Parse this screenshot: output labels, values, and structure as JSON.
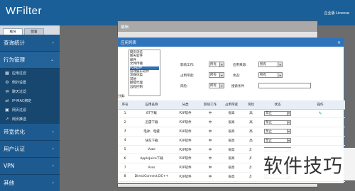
{
  "header": {
    "title": "WFilter",
    "license": "企业版 License"
  },
  "sidebar": {
    "tabs": [
      {
        "label": "概况"
      },
      {
        "label": "配置"
      }
    ],
    "sections": [
      {
        "label": "查询统计",
        "chevron": "›"
      },
      {
        "label": "行为管理",
        "chevron": "⌄"
      },
      {
        "label": "带宽优化",
        "chevron": "›"
      },
      {
        "label": "用户认证",
        "chevron": "›"
      },
      {
        "label": "VPN",
        "chevron": "›"
      },
      {
        "label": "其他",
        "chevron": "›"
      }
    ],
    "sub_items": [
      {
        "label": "应用过滤",
        "icon": "grid-icon",
        "glyph": "▦"
      },
      {
        "label": "例外设置",
        "icon": "gear-icon",
        "glyph": "⚙"
      },
      {
        "label": "聊天过滤",
        "icon": "chat-icon",
        "glyph": "✉"
      },
      {
        "label": "IP-MAC绑定",
        "icon": "link-icon",
        "glyph": "⇄"
      },
      {
        "label": "网页过滤",
        "icon": "web-icon",
        "glyph": "▣"
      },
      {
        "label": "网页推送",
        "icon": "push-icon",
        "glyph": "↗"
      }
    ]
  },
  "outer_modal": {
    "title": "编辑"
  },
  "modal": {
    "title": "应用列表",
    "close": "×",
    "categories": [
      "网页浏览",
      "聊天软件",
      "邮件",
      "文件传输",
      "P2P软件",
      "游戏娱乐软件",
      "流媒体类",
      "其他",
      "翻墙代理",
      "远程控制"
    ],
    "selected_category": "P2P软件",
    "category_label": "分类:",
    "filters": {
      "impact_label": "影响工作:",
      "impact_value": "所有",
      "source_label": "应用来源:",
      "source_value": "所有",
      "bandwidth_label": "占用带宽:",
      "bandwidth_value": "所有",
      "status_label": "状态:",
      "status_value": "所有",
      "risk_label": "风险:",
      "risk_value": "所有",
      "search_label": "搜索条件",
      "search_value": ""
    },
    "table": {
      "headers": [
        "序号",
        "应用名称",
        "分类",
        "影响工作",
        "占用带宽",
        "风险",
        "状态",
        "操作"
      ],
      "rows": [
        {
          "no": "1",
          "name": "BT下载",
          "category": "P2P软件",
          "impact": "中",
          "bandwidth": "很高",
          "risk": "高",
          "status": "禁止"
        },
        {
          "no": "2",
          "name": "迅雷下载",
          "category": "P2P软件",
          "impact": "中",
          "bandwidth": "很高",
          "risk": "高",
          "status": "禁止"
        },
        {
          "no": "3",
          "name": "电驴、电骡",
          "category": "P2P软件",
          "impact": "中",
          "bandwidth": "很高",
          "risk": "高",
          "status": "禁止"
        },
        {
          "no": "4",
          "name": "快车下载",
          "category": "P2P软件",
          "impact": "中",
          "bandwidth": "很高",
          "risk": "高",
          "status": "禁止"
        },
        {
          "no": "5",
          "name": "Vuze",
          "category": "P2P软件",
          "impact": "中",
          "bandwidth": "很高",
          "risk": "高",
          "status": "禁止"
        },
        {
          "no": "6",
          "name": "AppleJuice下载",
          "category": "P2P软件",
          "impact": "中",
          "bandwidth": "很高",
          "risk": "高",
          "status": "禁止"
        },
        {
          "no": "7",
          "name": "Ares",
          "category": "P2P软件",
          "impact": "中",
          "bandwidth": "很高",
          "risk": "高",
          "status": "禁止"
        },
        {
          "no": "8",
          "name": "DirectConnect,DC++",
          "category": "P2P软件",
          "impact": "中",
          "bandwidth": "很高",
          "risk": "高",
          "status": "禁止"
        }
      ]
    }
  },
  "watermark": "软件技巧"
}
